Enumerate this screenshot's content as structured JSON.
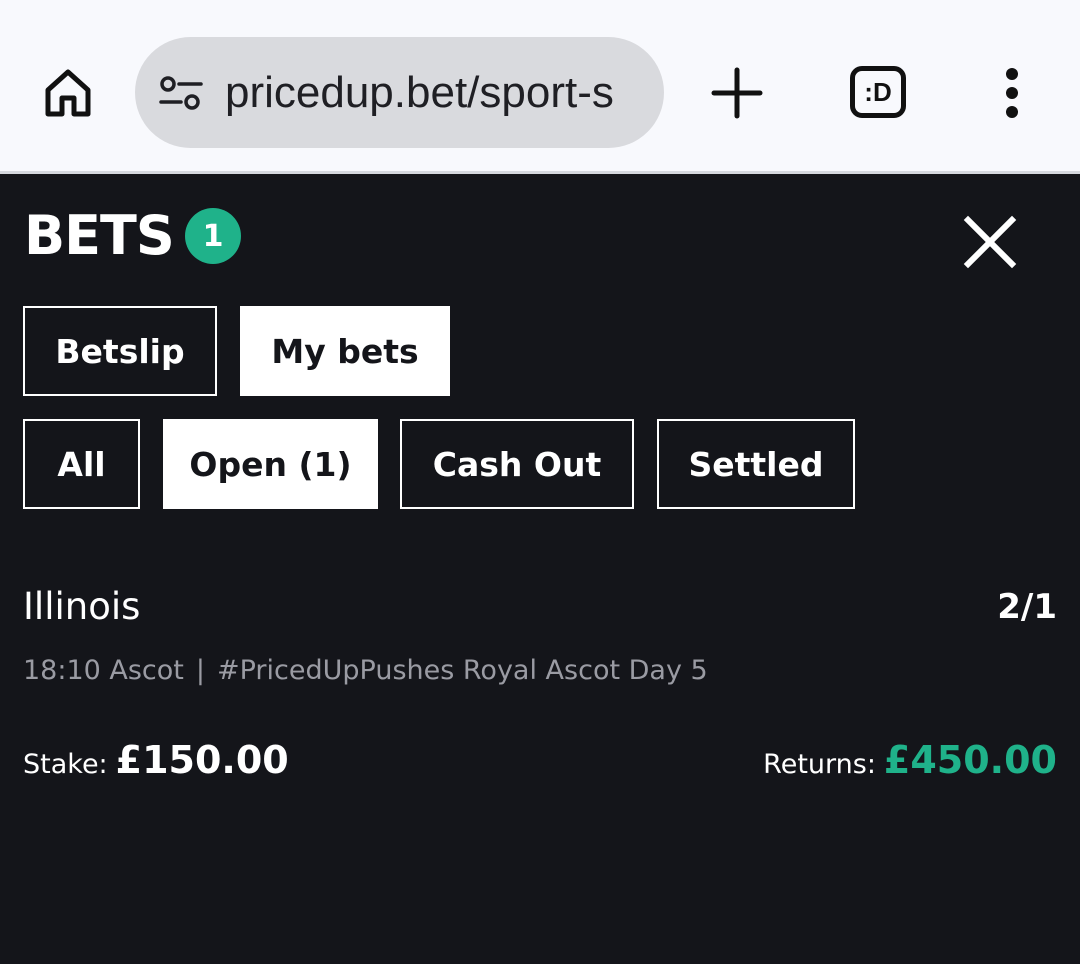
{
  "browser": {
    "url": "pricedup.bet/sport-s",
    "tabs_label": ":D"
  },
  "header": {
    "title": "BETS",
    "badge_count": "1"
  },
  "main_tabs": [
    {
      "label": "Betslip",
      "active": false
    },
    {
      "label": "My bets",
      "active": true
    }
  ],
  "filter_tabs": [
    {
      "label": "All",
      "active": false
    },
    {
      "label": "Open (1)",
      "active": true
    },
    {
      "label": "Cash Out",
      "active": false
    },
    {
      "label": "Settled",
      "active": false
    }
  ],
  "bet": {
    "selection": "Illinois",
    "odds": "2/1",
    "event_time": "18:10 Ascot",
    "separator": "|",
    "event_market": "#PricedUpPushes Royal Ascot Day 5",
    "stake_label": "Stake:",
    "stake_value": "£150.00",
    "returns_label": "Returns:",
    "returns_value": "£450.00"
  },
  "colors": {
    "accent": "#1fb28a",
    "background": "#14151a",
    "muted_text": "#9a9ba3"
  }
}
